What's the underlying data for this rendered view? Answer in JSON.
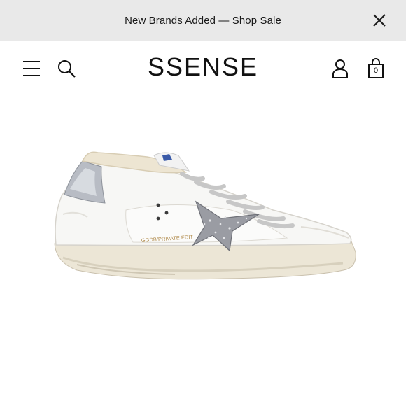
{
  "promo": {
    "text": "New Brands Added — Shop Sale"
  },
  "header": {
    "logo": "SSENSE",
    "bag_count": "0"
  },
  "icons": {
    "close": "close-icon",
    "menu": "hamburger-menu-icon",
    "search": "search-icon",
    "account": "user-account-icon",
    "bag": "shopping-bag-icon"
  },
  "product": {
    "image_label": "white leather sneaker with shearling lining and glitter star",
    "heel_text": "GGDB/PRIVATE EDIT"
  },
  "colors": {
    "promo_bg": "#e9e9e9",
    "text": "#111111",
    "background": "#ffffff"
  }
}
